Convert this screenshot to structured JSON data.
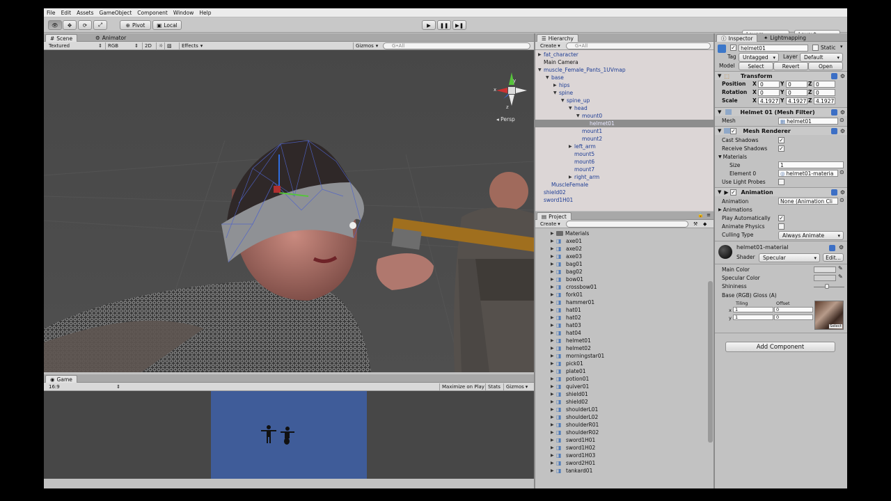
{
  "menu": [
    "File",
    "Edit",
    "Assets",
    "GameObject",
    "Component",
    "Window",
    "Help"
  ],
  "toolbar": {
    "pivot": "Pivot",
    "local": "Local",
    "layers": "Layers",
    "layout": "Layout"
  },
  "scene": {
    "tabs": [
      "Scene",
      "Animator"
    ],
    "shading": "Textured",
    "render": "RGB",
    "mode2d": "2D",
    "effects": "Effects",
    "gizmos": "Gizmos",
    "search": "G•All",
    "persp": "Persp",
    "axis": {
      "y": "y",
      "x": "x",
      "z": "z"
    }
  },
  "game": {
    "tab": "Game",
    "aspect": "16:9",
    "maximize": "Maximize on Play",
    "stats": "Stats",
    "gizmos": "Gizmos"
  },
  "hierarchy": {
    "tab": "Hierarchy",
    "create": "Create",
    "search": "G•All",
    "items": [
      {
        "label": "fat_character",
        "indent": 0,
        "arrow": "▶",
        "blue": true
      },
      {
        "label": "Main Camera",
        "indent": 0,
        "arrow": "",
        "blue": false
      },
      {
        "label": "muscle_Female_Pants_1UVmap",
        "indent": 0,
        "arrow": "▼",
        "blue": true
      },
      {
        "label": "base",
        "indent": 1,
        "arrow": "▼",
        "blue": true
      },
      {
        "label": "hips",
        "indent": 2,
        "arrow": "▶",
        "blue": true
      },
      {
        "label": "spine",
        "indent": 2,
        "arrow": "▼",
        "blue": true
      },
      {
        "label": "spine_up",
        "indent": 3,
        "arrow": "▼",
        "blue": true
      },
      {
        "label": "head",
        "indent": 4,
        "arrow": "▼",
        "blue": true
      },
      {
        "label": "mount0",
        "indent": 5,
        "arrow": "▼",
        "blue": true
      },
      {
        "label": "helmet01",
        "indent": 6,
        "arrow": "",
        "blue": true,
        "selected": true
      },
      {
        "label": "mount1",
        "indent": 5,
        "arrow": "",
        "blue": true
      },
      {
        "label": "mount2",
        "indent": 5,
        "arrow": "",
        "blue": true
      },
      {
        "label": "left_arm",
        "indent": 4,
        "arrow": "▶",
        "blue": true
      },
      {
        "label": "mount5",
        "indent": 4,
        "arrow": "",
        "blue": true
      },
      {
        "label": "mount6",
        "indent": 4,
        "arrow": "",
        "blue": true
      },
      {
        "label": "mount7",
        "indent": 4,
        "arrow": "",
        "blue": true
      },
      {
        "label": "right_arm",
        "indent": 4,
        "arrow": "▶",
        "blue": true
      },
      {
        "label": "MuscleFemale",
        "indent": 1,
        "arrow": "",
        "blue": true
      },
      {
        "label": "shield02",
        "indent": 0,
        "arrow": "",
        "blue": true
      },
      {
        "label": "sword1H01",
        "indent": 0,
        "arrow": "",
        "blue": true
      }
    ]
  },
  "project": {
    "tab": "Project",
    "create": "Create",
    "items": [
      "Materials",
      "axe01",
      "axe02",
      "axe03",
      "bag01",
      "bag02",
      "bow01",
      "crossbow01",
      "fork01",
      "hammer01",
      "hat01",
      "hat02",
      "hat03",
      "hat04",
      "helmet01",
      "helmet02",
      "morningstar01",
      "pick01",
      "plate01",
      "potion01",
      "quiver01",
      "shield01",
      "shield02",
      "shoulderL01",
      "shoulderL02",
      "shoulderR01",
      "shoulderR02",
      "sword1H01",
      "sword1H02",
      "sword1H03",
      "sword2H01",
      "tankard01"
    ]
  },
  "inspector": {
    "tabs": [
      "Inspector",
      "Lightmapping"
    ],
    "name": "helmet01",
    "static": "Static",
    "tag_label": "Tag",
    "tag": "Untagged",
    "layer_label": "Layer",
    "layer": "Default",
    "model_label": "Model",
    "select": "Select",
    "revert": "Revert",
    "open": "Open",
    "transform": {
      "title": "Transform",
      "rows": [
        {
          "label": "Position",
          "x": "0",
          "y": "0",
          "z": "0"
        },
        {
          "label": "Rotation",
          "x": "0",
          "y": "0",
          "z": "0"
        },
        {
          "label": "Scale",
          "x": "4.1927",
          "y": "4.1927",
          "z": "4.1927"
        }
      ]
    },
    "mesh_filter": {
      "title": "Helmet 01 (Mesh Filter)",
      "mesh_label": "Mesh",
      "mesh": "helmet01"
    },
    "mesh_renderer": {
      "title": "Mesh Renderer",
      "cast": "Cast Shadows",
      "receive": "Receive Shadows",
      "materials": "Materials",
      "size_label": "Size",
      "size": "1",
      "elem_label": "Element 0",
      "elem": "helmet01-materia",
      "probes": "Use Light Probes"
    },
    "animation": {
      "title": "Animation",
      "anim_label": "Animation",
      "anim": "None (Animation Cli",
      "anims": "Animations",
      "play": "Play Automatically",
      "physics": "Animate Physics",
      "culling_label": "Culling Type",
      "culling": "Always Animate"
    },
    "material": {
      "name": "helmet01-material",
      "shader_label": "Shader",
      "shader": "Specular",
      "edit": "Edit...",
      "main": "Main Color",
      "spec": "Specular Color",
      "shine": "Shininess",
      "base": "Base (RGB) Gloss (A)",
      "tiling": "Tiling",
      "offset": "Offset",
      "x": "x",
      "y": "y",
      "tx": "1",
      "ty": "1",
      "ox": "0",
      "oy": "0",
      "select": "Select"
    },
    "add_component": "Add Component"
  }
}
